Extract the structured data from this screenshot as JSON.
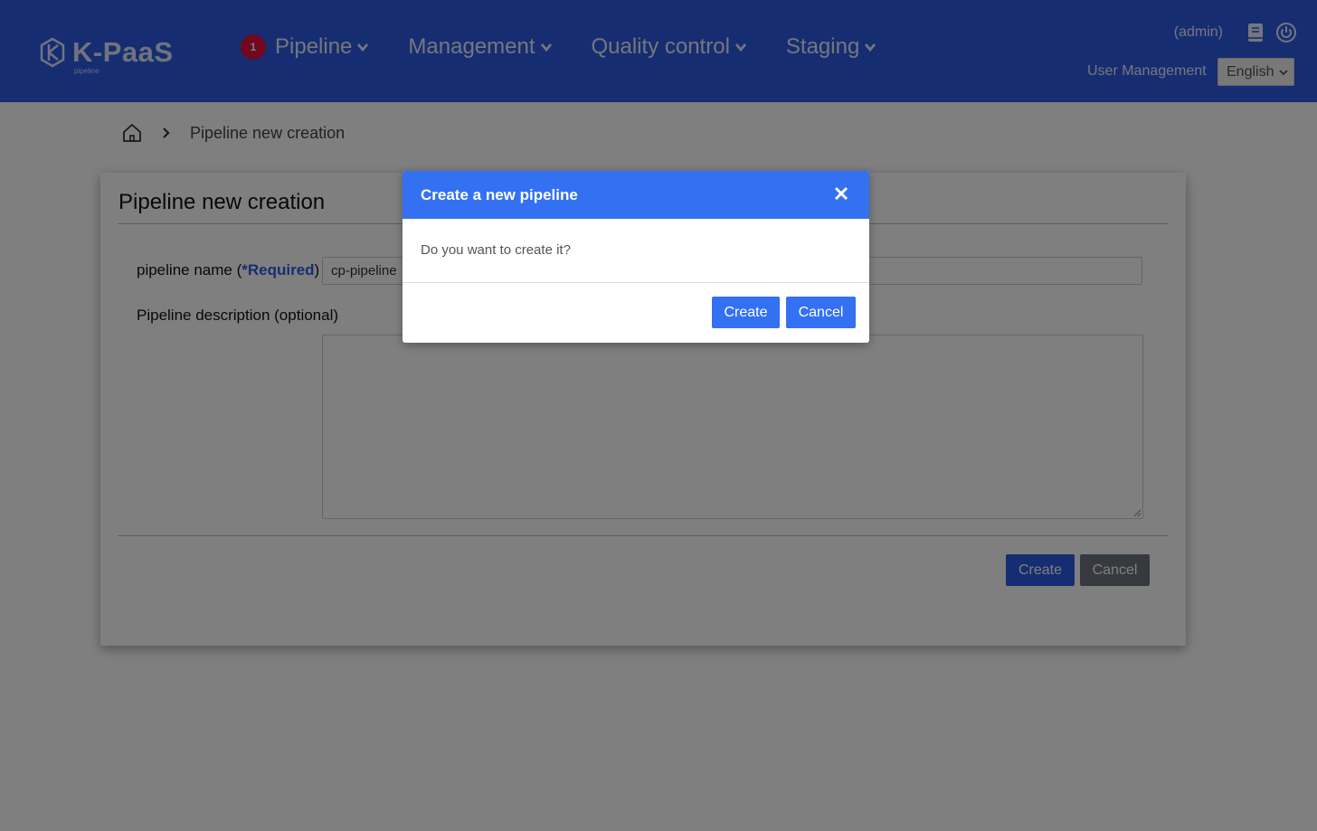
{
  "header": {
    "logo_text": "K-PaaS",
    "logo_sub": "pipeline",
    "nav": [
      {
        "label": "Pipeline",
        "badge": "1"
      },
      {
        "label": "Management"
      },
      {
        "label": "Quality control"
      },
      {
        "label": "Staging"
      }
    ],
    "user": "(admin)",
    "user_management": "User Management",
    "language": "English",
    "icons": [
      "manual-book-icon",
      "power-icon"
    ]
  },
  "breadcrumb": {
    "current": "Pipeline new creation"
  },
  "panel": {
    "title": "Pipeline new creation",
    "name_label_prefix": "pipeline name (",
    "name_label_required": "*Required",
    "name_label_suffix": ")",
    "name_value": "cp-pipeline",
    "description_label": "Pipeline description (optional)",
    "description_value": "",
    "create_label": "Create",
    "cancel_label": "Cancel"
  },
  "modal": {
    "title": "Create a new pipeline",
    "message": "Do you want to create it?",
    "create_label": "Create",
    "cancel_label": "Cancel"
  },
  "colors": {
    "header_bg": "#2f5be4",
    "modal_header_bg": "#3470f2",
    "badge_bg": "#e0103c",
    "cancel_gray": "#6c757d"
  }
}
